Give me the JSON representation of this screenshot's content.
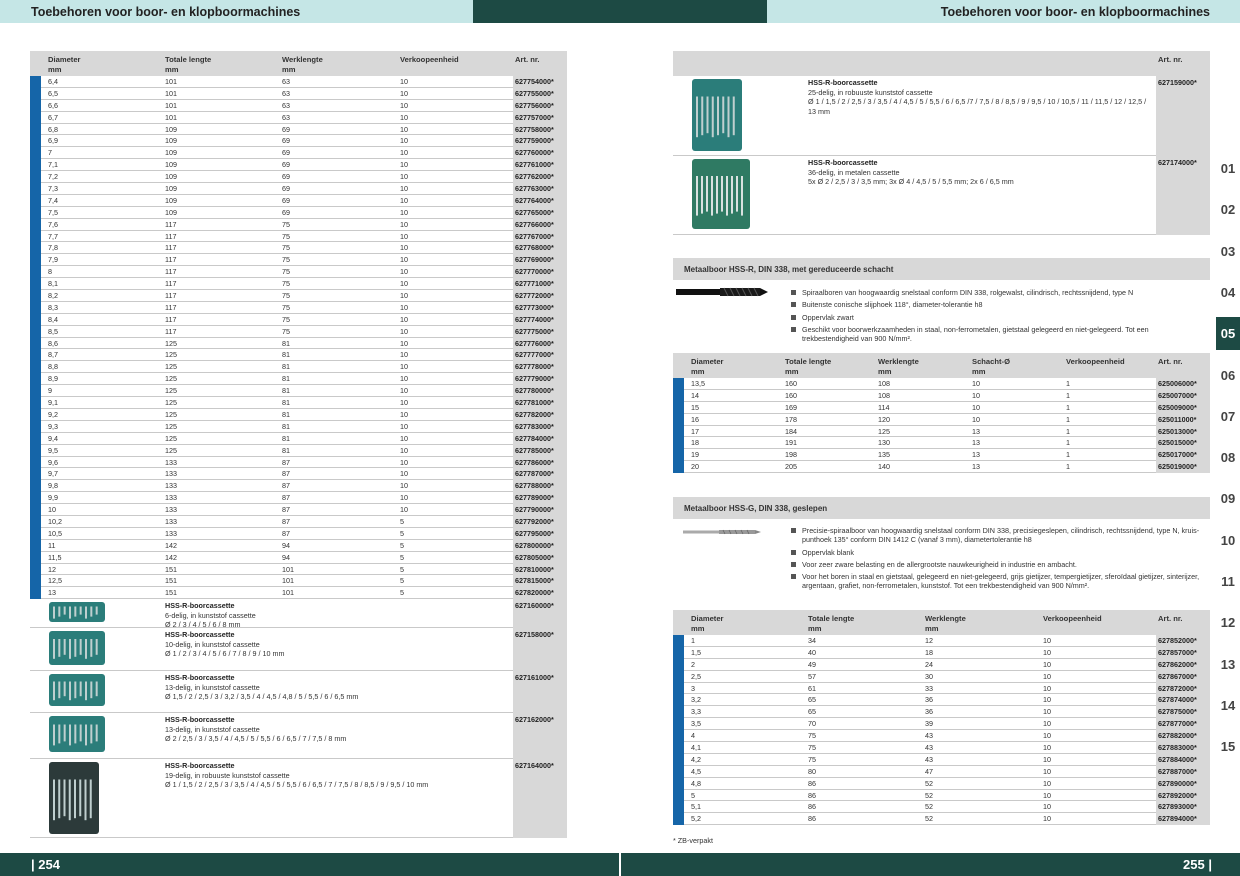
{
  "header": {
    "left_title": "Toebehoren voor boor- en klopboormachines",
    "right_title": "Toebehoren voor boor- en klopboormachines"
  },
  "footer": {
    "left_page": "| 254",
    "right_page": "255 |"
  },
  "colors": {
    "bar_dark": "#1d4a44",
    "bar_light": "#c5e6e6",
    "row_marker": "#1565a8",
    "art_cell": "#d8d8d8"
  },
  "left_table": {
    "headers": [
      "Diameter mm",
      "Totale lengte mm",
      "Werklengte mm",
      "Verkoopeenheid",
      "Art. nr."
    ],
    "rows": [
      [
        "6,4",
        "101",
        "63",
        "10",
        "627754000*"
      ],
      [
        "6,5",
        "101",
        "63",
        "10",
        "627755000*"
      ],
      [
        "6,6",
        "101",
        "63",
        "10",
        "627756000*"
      ],
      [
        "6,7",
        "101",
        "63",
        "10",
        "627757000*"
      ],
      [
        "6,8",
        "109",
        "69",
        "10",
        "627758000*"
      ],
      [
        "6,9",
        "109",
        "69",
        "10",
        "627759000*"
      ],
      [
        "7",
        "109",
        "69",
        "10",
        "627760000*"
      ],
      [
        "7,1",
        "109",
        "69",
        "10",
        "627761000*"
      ],
      [
        "7,2",
        "109",
        "69",
        "10",
        "627762000*"
      ],
      [
        "7,3",
        "109",
        "69",
        "10",
        "627763000*"
      ],
      [
        "7,4",
        "109",
        "69",
        "10",
        "627764000*"
      ],
      [
        "7,5",
        "109",
        "69",
        "10",
        "627765000*"
      ],
      [
        "7,6",
        "117",
        "75",
        "10",
        "627766000*"
      ],
      [
        "7,7",
        "117",
        "75",
        "10",
        "627767000*"
      ],
      [
        "7,8",
        "117",
        "75",
        "10",
        "627768000*"
      ],
      [
        "7,9",
        "117",
        "75",
        "10",
        "627769000*"
      ],
      [
        "8",
        "117",
        "75",
        "10",
        "627770000*"
      ],
      [
        "8,1",
        "117",
        "75",
        "10",
        "627771000*"
      ],
      [
        "8,2",
        "117",
        "75",
        "10",
        "627772000*"
      ],
      [
        "8,3",
        "117",
        "75",
        "10",
        "627773000*"
      ],
      [
        "8,4",
        "117",
        "75",
        "10",
        "627774000*"
      ],
      [
        "8,5",
        "117",
        "75",
        "10",
        "627775000*"
      ],
      [
        "8,6",
        "125",
        "81",
        "10",
        "627776000*"
      ],
      [
        "8,7",
        "125",
        "81",
        "10",
        "627777000*"
      ],
      [
        "8,8",
        "125",
        "81",
        "10",
        "627778000*"
      ],
      [
        "8,9",
        "125",
        "81",
        "10",
        "627779000*"
      ],
      [
        "9",
        "125",
        "81",
        "10",
        "627780000*"
      ],
      [
        "9,1",
        "125",
        "81",
        "10",
        "627781000*"
      ],
      [
        "9,2",
        "125",
        "81",
        "10",
        "627782000*"
      ],
      [
        "9,3",
        "125",
        "81",
        "10",
        "627783000*"
      ],
      [
        "9,4",
        "125",
        "81",
        "10",
        "627784000*"
      ],
      [
        "9,5",
        "125",
        "81",
        "10",
        "627785000*"
      ],
      [
        "9,6",
        "133",
        "87",
        "10",
        "627786000*"
      ],
      [
        "9,7",
        "133",
        "87",
        "10",
        "627787000*"
      ],
      [
        "9,8",
        "133",
        "87",
        "10",
        "627788000*"
      ],
      [
        "9,9",
        "133",
        "87",
        "10",
        "627789000*"
      ],
      [
        "10",
        "133",
        "87",
        "10",
        "627790000*"
      ],
      [
        "10,2",
        "133",
        "87",
        "5",
        "627792000*"
      ],
      [
        "10,5",
        "133",
        "87",
        "5",
        "627795000*"
      ],
      [
        "11",
        "142",
        "94",
        "5",
        "627800000*"
      ],
      [
        "11,5",
        "142",
        "94",
        "5",
        "627805000*"
      ],
      [
        "12",
        "151",
        "101",
        "5",
        "627810000*"
      ],
      [
        "12,5",
        "151",
        "101",
        "5",
        "627815000*"
      ],
      [
        "13",
        "151",
        "101",
        "5",
        "627820000*"
      ]
    ],
    "cassettes": [
      {
        "title": "HSS-R-boorcassette",
        "lines": [
          "6-delig, in kunststof cassette",
          "Ø 2 / 3 / 4 / 5 / 6 / 8 mm"
        ],
        "art": "627160000*"
      },
      {
        "title": "HSS-R-boorcassette",
        "lines": [
          "10-delig, in kunststof cassette",
          "Ø 1 / 2 / 3 / 4 / 5 / 6 / 7 / 8 / 9 / 10 mm"
        ],
        "art": "627158000*"
      },
      {
        "title": "HSS-R-boorcassette",
        "lines": [
          "13-delig, in kunststof cassette",
          "Ø 1,5 / 2 / 2,5 / 3 / 3,2 / 3,5 / 4 / 4,5 / 4,8 / 5 / 5,5 / 6 / 6,5 mm"
        ],
        "art": "627161000*"
      },
      {
        "title": "HSS-R-boorcassette",
        "lines": [
          "13-delig, in kunststof cassette",
          "Ø 2 / 2,5 / 3 / 3,5 / 4 / 4,5 / 5 / 5,5 / 6 / 6,5 / 7 / 7,5 / 8 mm"
        ],
        "art": "627162000*"
      },
      {
        "title": "HSS-R-boorcassette",
        "lines": [
          "19-delig, in robuuste kunststof cassette",
          "Ø 1 / 1,5 / 2 / 2,5 / 3 / 3,5 / 4 / 4,5 / 5 / 5,5 / 6 / 6,5 / 7 / 7,5 / 8 / 8,5 / 9 / 9,5 / 10 mm"
        ],
        "art": "627164000*"
      }
    ]
  },
  "right_top": {
    "art_header": "Art. nr.",
    "cassettes": [
      {
        "title": "HSS-R-boorcassette",
        "lines": [
          "25-delig, in robuuste kunststof cassette",
          "Ø 1 / 1,5 / 2 / 2,5 / 3 / 3,5 / 4 / 4,5 / 5 / 5,5 / 6 / 6,5 /7 / 7,5 / 8 / 8,5 / 9 / 9,5 / 10 / 10,5 / 11 / 11,5 / 12 / 12,5 /",
          "13 mm"
        ],
        "art": "627159000*"
      },
      {
        "title": "HSS-R-boorcassette",
        "lines": [
          "36-delig, in metalen cassette",
          "5x Ø 2 / 2,5 / 3 / 3,5 mm;  3x Ø 4 / 4,5 / 5 / 5,5 mm;  2x 6 / 6,5 mm"
        ],
        "art": "627174000*"
      }
    ]
  },
  "section1": {
    "title": "Metaalboor HSS-R, DIN 338, met gereduceerde schacht",
    "bullets": [
      "Spiraalboren van hoogwaardig snelstaal conform DIN 338, rolgewalst, cilindrisch, rechtssnijdend, type N",
      "Buitenste conische slijphoek 118°, diameter-tolerantie h8",
      "Oppervlak zwart",
      "Geschikt voor boorwerkzaamheden in staal, non-ferrometalen, gietstaal gelegeerd en niet-gelegeerd. Tot een trekbestendigheid van 900 N/mm²."
    ],
    "headers": [
      "Diameter mm",
      "Totale lengte mm",
      "Werklengte mm",
      "Schacht-Ø mm",
      "Verkoopeenheid",
      "Art. nr."
    ],
    "rows": [
      [
        "13,5",
        "160",
        "108",
        "10",
        "1",
        "625006000*"
      ],
      [
        "14",
        "160",
        "108",
        "10",
        "1",
        "625007000*"
      ],
      [
        "15",
        "169",
        "114",
        "10",
        "1",
        "625009000*"
      ],
      [
        "16",
        "178",
        "120",
        "10",
        "1",
        "625011000*"
      ],
      [
        "17",
        "184",
        "125",
        "13",
        "1",
        "625013000*"
      ],
      [
        "18",
        "191",
        "130",
        "13",
        "1",
        "625015000*"
      ],
      [
        "19",
        "198",
        "135",
        "13",
        "1",
        "625017000*"
      ],
      [
        "20",
        "205",
        "140",
        "13",
        "1",
        "625019000*"
      ]
    ]
  },
  "section2": {
    "title": "Metaalboor HSS-G, DIN 338, geslepen",
    "bullets": [
      "Precisie-spiraalboor van hoogwaardig snelstaal conform DIN 338, precisiegeslepen, cilindrisch, rechtssnijdend, type N, kruis-punthoek 135° conform DIN 1412 C (vanaf 3 mm), diametertolerantie h8",
      "Oppervlak blank",
      "Voor zeer zware belasting en de allergrootste nauwkeurigheid in industrie en ambacht.",
      "Voor het boren in staal en gietstaal, gelegeerd en niet-gelegeerd, grijs gietijzer, tempergietijzer, sferoïdaal gietijzer, sinterijzer, argentaan, grafiet, non-ferrometalen, kunststof. Tot een trekbestendigheid van 900 N/mm²."
    ],
    "headers": [
      "Diameter mm",
      "Totale lengte mm",
      "Werklengte mm",
      "Verkoopeenheid",
      "Art. nr."
    ],
    "rows": [
      [
        "1",
        "34",
        "12",
        "10",
        "627852000*"
      ],
      [
        "1,5",
        "40",
        "18",
        "10",
        "627857000*"
      ],
      [
        "2",
        "49",
        "24",
        "10",
        "627862000*"
      ],
      [
        "2,5",
        "57",
        "30",
        "10",
        "627867000*"
      ],
      [
        "3",
        "61",
        "33",
        "10",
        "627872000*"
      ],
      [
        "3,2",
        "65",
        "36",
        "10",
        "627874000*"
      ],
      [
        "3,3",
        "65",
        "36",
        "10",
        "627875000*"
      ],
      [
        "3,5",
        "70",
        "39",
        "10",
        "627877000*"
      ],
      [
        "4",
        "75",
        "43",
        "10",
        "627882000*"
      ],
      [
        "4,1",
        "75",
        "43",
        "10",
        "627883000*"
      ],
      [
        "4,2",
        "75",
        "43",
        "10",
        "627884000*"
      ],
      [
        "4,5",
        "80",
        "47",
        "10",
        "627887000*"
      ],
      [
        "4,8",
        "86",
        "52",
        "10",
        "627890000*"
      ],
      [
        "5",
        "86",
        "52",
        "10",
        "627892000*"
      ],
      [
        "5,1",
        "86",
        "52",
        "10",
        "627893000*"
      ],
      [
        "5,2",
        "86",
        "52",
        "10",
        "627894000*"
      ]
    ]
  },
  "footnote": "* ZB-verpakt",
  "chapters": {
    "items": [
      "01",
      "02",
      "03",
      "04",
      "05",
      "06",
      "07",
      "08",
      "09",
      "10",
      "11",
      "12",
      "13",
      "14",
      "15"
    ],
    "active": "05"
  }
}
